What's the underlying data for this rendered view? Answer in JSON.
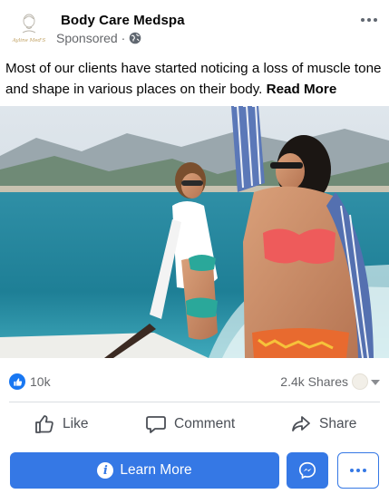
{
  "post": {
    "page_name": "Body Care Medspa",
    "sponsored_label": "Sponsored · ",
    "avatar_script": "Ayline Med'S",
    "caption_text": "Most of our clients have started noticing a loss of muscle tone and shape in various places on their body. ",
    "read_more_label": "Read More"
  },
  "stats": {
    "like_count": "10k",
    "shares_label": "2.4k Shares"
  },
  "actions": {
    "like_label": "Like",
    "comment_label": "Comment",
    "share_label": "Share"
  },
  "cta": {
    "learn_more_label": "Learn More"
  },
  "icons": {
    "globe": "globe-icon",
    "more": "more-horizontal-icon",
    "like_reaction": "thumbs-up-icon",
    "like": "thumbs-up-outline-icon",
    "comment": "speech-bubble-icon",
    "share": "share-arrow-icon",
    "info": "info-icon",
    "messenger": "messenger-icon"
  },
  "colors": {
    "brand_blue": "#3578e5",
    "reaction_blue": "#1877f2",
    "secondary_text": "#65676b"
  }
}
